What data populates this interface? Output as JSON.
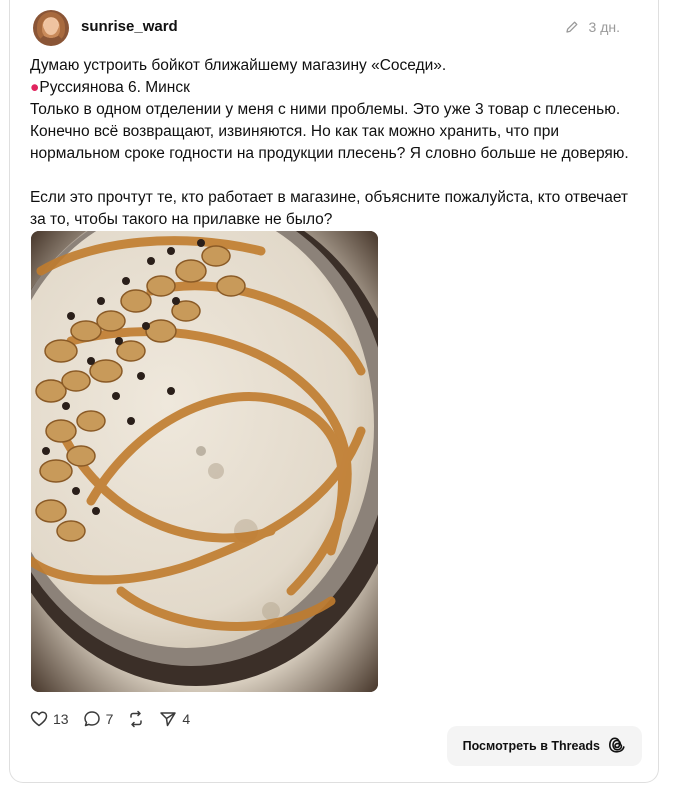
{
  "post": {
    "username": "sunrise_ward",
    "time": "3 дн.",
    "lines": [
      "Думаю устроить бойкот ближайшему магазину «Соседи».",
      "📍Руссиянова 6. Минск",
      "Только в одном отделении у меня с ними проблемы. Это уже 3 товар с плесенью.",
      "Конечно всё возвращают, извиняются. Но как так можно хранить, что при нормальном сроке годности на продукции плесень? Я словно больше не доверяю.",
      "",
      "Если это прочтут те, кто работает в магазине, объясните пожалуйста, кто отвечает за то, чтобы такого на прилавке не было?"
    ],
    "location_text": "Руссиянова 6. Минск",
    "location_icon": "pin-icon"
  },
  "actions": {
    "likes": "13",
    "comments": "7",
    "shares": "4"
  },
  "threads_button": {
    "label": "Посмотреть в Threads"
  }
}
